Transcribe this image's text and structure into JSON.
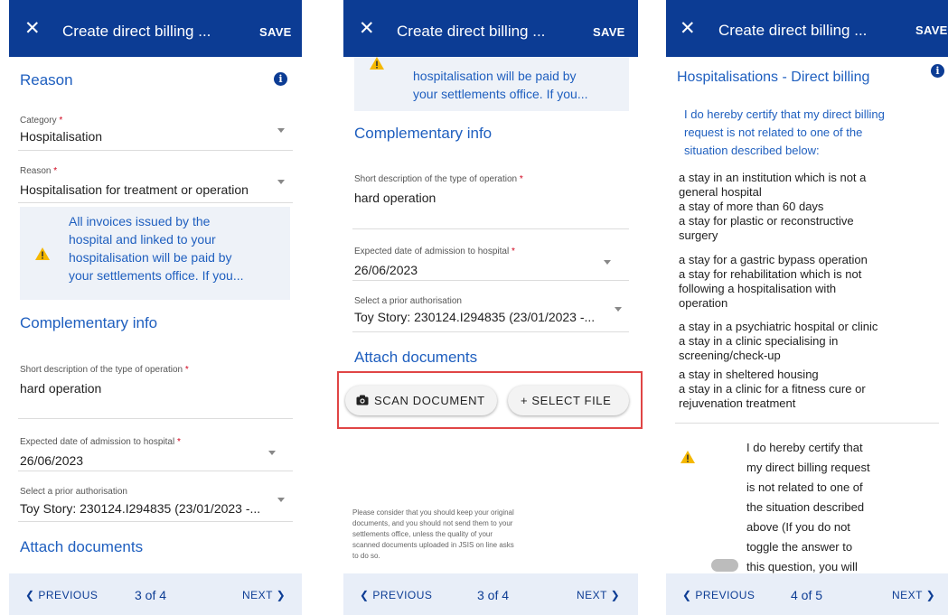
{
  "colors": {
    "primary": "#0c3c94",
    "link": "#1f5fbf",
    "warning": "#f5b800",
    "highlight": "#e04545"
  },
  "common": {
    "close_icon": "close-icon",
    "save_label": "SAVE",
    "title": "Create direct billing ...",
    "previous_label": "PREVIOUS",
    "next_label": "NEXT"
  },
  "screen1": {
    "reason_title": "Reason",
    "category_label": "Category",
    "category_value": "Hospitalisation",
    "reason_label": "Reason",
    "reason_value": "Hospitalisation for treatment or operation",
    "alert_lines": [
      "All invoices issued by the",
      "hospital and linked to your",
      "hospitalisation will be paid by",
      "your settlements office. If you..."
    ],
    "complementary_title": "Complementary info",
    "short_desc_label": "Short description of the type of operation",
    "short_desc_value": "hard operation",
    "admission_label": "Expected date of admission to hospital",
    "admission_value": "26/06/2023",
    "prior_auth_label": "Select a prior authorisation",
    "prior_auth_value": "Toy Story: 230124.I294835 (23/01/2023 -...",
    "attach_title": "Attach documents",
    "page": "3 of 4"
  },
  "screen2": {
    "alert_lines": [
      "hospitalisation will be paid by",
      "your settlements office. If you..."
    ],
    "complementary_title": "Complementary info",
    "short_desc_label": "Short description of the type of operation",
    "short_desc_value": "hard operation",
    "admission_label": "Expected date of admission to hospital",
    "admission_value": "26/06/2023",
    "prior_auth_label": "Select a prior authorisation",
    "prior_auth_value": "Toy Story: 230124.I294835 (23/01/2023 -...",
    "attach_title": "Attach documents",
    "scan_label": "SCAN DOCUMENT",
    "select_label": "+ SELECT FILE",
    "note_lines": [
      "Please consider that you should keep your original",
      "documents, and you should not send them to your",
      "settlements office, unless the quality of your",
      "scanned documents uploaded in JSIS on line asks",
      "to do so."
    ],
    "page": "3 of 4"
  },
  "screen3": {
    "title": "Create direct billing ...",
    "save_label": "SAVE",
    "section_title": "Hospitalisations - Direct billing",
    "intro_lines": [
      "I do hereby certify that my direct billing",
      "request is not related to one of the",
      "situation described below:"
    ],
    "list_lines": [
      "a stay in an institution which is not a",
      "general hospital",
      "a stay of more than 60 days",
      "a stay for plastic or reconstructive",
      "surgery",
      "a stay for a gastric bypass operation",
      "a stay for rehabilitation which is not",
      "following a hospitalisation with",
      "operation",
      "a stay in a psychiatric hospital or clinic",
      "a stay in a clinic specialising in",
      "screening/check-up",
      "a stay in sheltered housing",
      "a stay in a clinic for a fitness cure or",
      "rejuvenation treatment"
    ],
    "cert_lines": [
      "I do hereby certify that",
      "my direct billing request",
      "is not related to one of",
      "the situation described",
      "above (If you do not",
      "toggle the answer to",
      "this question, you will"
    ],
    "page": "4 of 5"
  }
}
